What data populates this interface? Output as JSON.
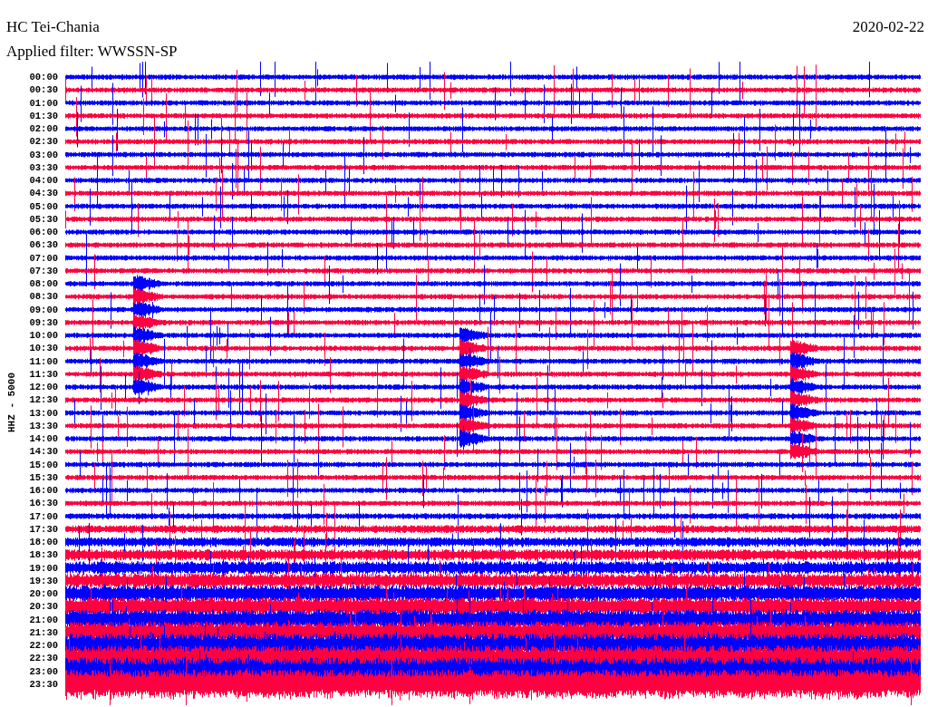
{
  "header": {
    "station": "HC Tei-Chania",
    "date": "2020-02-22",
    "filter": "Applied filter: WWSSN-SP"
  },
  "axis_label": "HHZ - 5000",
  "rows": [
    {
      "time": "00:00"
    },
    {
      "time": "00:30"
    },
    {
      "time": "01:00"
    },
    {
      "time": "01:30"
    },
    {
      "time": "02:00"
    },
    {
      "time": "02:30"
    },
    {
      "time": "03:00"
    },
    {
      "time": "03:30"
    },
    {
      "time": "04:00"
    },
    {
      "time": "04:30"
    },
    {
      "time": "05:00"
    },
    {
      "time": "05:30"
    },
    {
      "time": "06:00"
    },
    {
      "time": "06:30"
    },
    {
      "time": "07:00"
    },
    {
      "time": "07:30"
    },
    {
      "time": "08:00"
    },
    {
      "time": "08:30"
    },
    {
      "time": "09:00"
    },
    {
      "time": "09:30"
    },
    {
      "time": "10:00"
    },
    {
      "time": "10:30"
    },
    {
      "time": "11:00"
    },
    {
      "time": "11:30"
    },
    {
      "time": "12:00"
    },
    {
      "time": "12:30"
    },
    {
      "time": "13:00"
    },
    {
      "time": "13:30"
    },
    {
      "time": "14:00"
    },
    {
      "time": "14:30"
    },
    {
      "time": "15:00"
    },
    {
      "time": "15:30"
    },
    {
      "time": "16:00"
    },
    {
      "time": "16:30"
    },
    {
      "time": "17:00"
    },
    {
      "time": "17:30"
    },
    {
      "time": "18:00"
    },
    {
      "time": "18:30"
    },
    {
      "time": "19:00"
    },
    {
      "time": "19:30"
    },
    {
      "time": "20:00"
    },
    {
      "time": "20:30"
    },
    {
      "time": "21:00"
    },
    {
      "time": "21:30"
    },
    {
      "time": "22:00"
    },
    {
      "time": "22:30"
    },
    {
      "time": "23:00"
    },
    {
      "time": "23:30"
    }
  ]
}
